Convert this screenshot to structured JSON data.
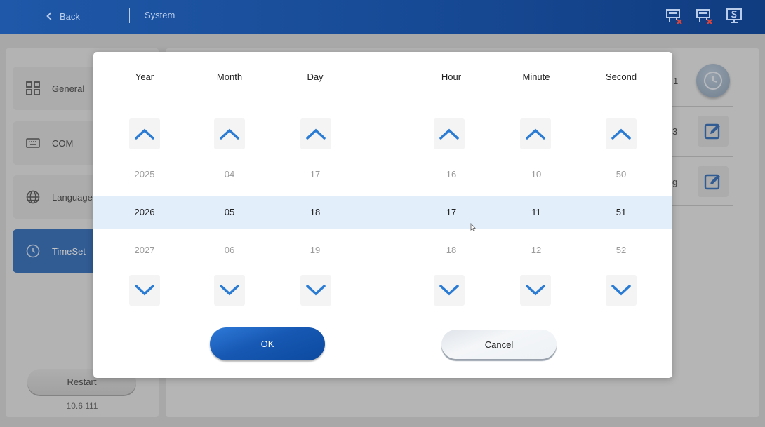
{
  "header": {
    "back_label": "Back",
    "section_title": "System",
    "status_icons": [
      "network-disconnected-icon",
      "network-disconnected-icon",
      "screen-s-icon"
    ]
  },
  "sidebar": {
    "items": [
      {
        "label": "General",
        "icon": "grid-icon",
        "active": false
      },
      {
        "label": "COM",
        "icon": "keyboard-icon",
        "active": false
      },
      {
        "label": "Language",
        "icon": "globe-icon",
        "active": false
      },
      {
        "label": "TimeSet",
        "icon": "clock-icon",
        "active": true
      }
    ],
    "restart_label": "Restart",
    "version": "10.6.111"
  },
  "main": {
    "row_fragments": [
      "1",
      "3",
      "g"
    ]
  },
  "dialog": {
    "columns": [
      {
        "header": "Year",
        "prev": "2025",
        "current": "2026",
        "next": "2027"
      },
      {
        "header": "Month",
        "prev": "04",
        "current": "05",
        "next": "06"
      },
      {
        "header": "Day",
        "prev": "17",
        "current": "18",
        "next": "19"
      },
      {
        "header": "Hour",
        "prev": "16",
        "current": "17",
        "next": "18"
      },
      {
        "header": "Minute",
        "prev": "10",
        "current": "11",
        "next": "12"
      },
      {
        "header": "Second",
        "prev": "50",
        "current": "51",
        "next": "52"
      }
    ],
    "ok_label": "OK",
    "cancel_label": "Cancel"
  },
  "colors": {
    "accent": "#1d5cb2",
    "topbar": "#174a95",
    "selection_band": "#e3eefb",
    "arrow": "#2a7bd3"
  }
}
